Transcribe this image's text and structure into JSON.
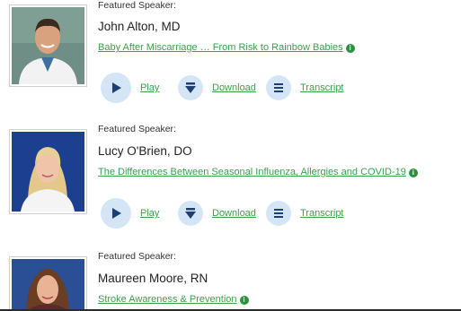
{
  "speakers": [
    {
      "featured_label": "Featured Speaker:",
      "name": "John Alton, MD",
      "talk_title": "Baby After Miscarriage … From Risk to Rainbow Babies",
      "actions": {
        "play": "Play",
        "download": "Download",
        "transcript": "Transcript"
      }
    },
    {
      "featured_label": "Featured Speaker:",
      "name": "Lucy O'Brien, DO",
      "talk_title": "The Differences Between Seasonal Influenza, Allergies and COVID-19",
      "actions": {
        "play": "Play",
        "download": "Download",
        "transcript": "Transcript"
      }
    },
    {
      "featured_label": "Featured Speaker:",
      "name": "Maureen Moore, RN",
      "talk_title": "Stroke Awareness & Prevention"
    }
  ],
  "colors": {
    "link_green": "#3aa14a",
    "icon_navy": "#1f3f73",
    "icon_bg": "#d4e6f6"
  },
  "icons": {
    "play": "play-icon",
    "download": "download-icon",
    "transcript": "transcript-icon",
    "info": "info-icon"
  }
}
